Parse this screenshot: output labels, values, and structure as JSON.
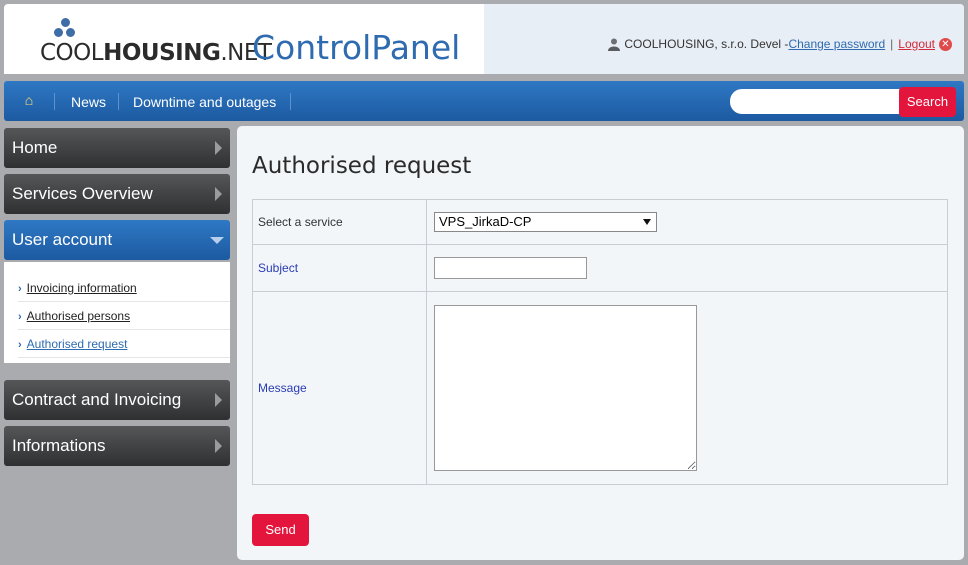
{
  "header": {
    "logo_part1": "COOL",
    "logo_part2": "HOUSING",
    "logo_part3": ".NET",
    "app_title": "ControlPanel",
    "user_text": "COOLHOUSING, s.r.o. Devel -",
    "change_password": "Change password",
    "separator": "|",
    "logout": "Logout"
  },
  "nav": {
    "home_icon": "⌂",
    "items": [
      "News",
      "Downtime and outages"
    ],
    "search_placeholder": "",
    "search_label": "Search"
  },
  "sidebar": {
    "items": [
      {
        "label": "Home"
      },
      {
        "label": "Services Overview"
      },
      {
        "label": "User account"
      },
      {
        "label": "Contract and Invoicing"
      },
      {
        "label": "Informations"
      }
    ],
    "submenu": [
      {
        "label": "Invoicing information"
      },
      {
        "label": "Authorised persons"
      },
      {
        "label": "Authorised request"
      }
    ]
  },
  "main": {
    "title": "Authorised request",
    "form": {
      "service_label": "Select a service",
      "service_value": "VPS_JirkaD-CP",
      "subject_label": "Subject",
      "subject_value": "",
      "message_label": "Message",
      "message_value": ""
    },
    "send_label": "Send"
  },
  "colors": {
    "brand_blue": "#2f6bb0",
    "nav_blue": "#1c5aa1",
    "accent_red": "#e3153c",
    "sidebar_dark": "#3a3b3d"
  }
}
